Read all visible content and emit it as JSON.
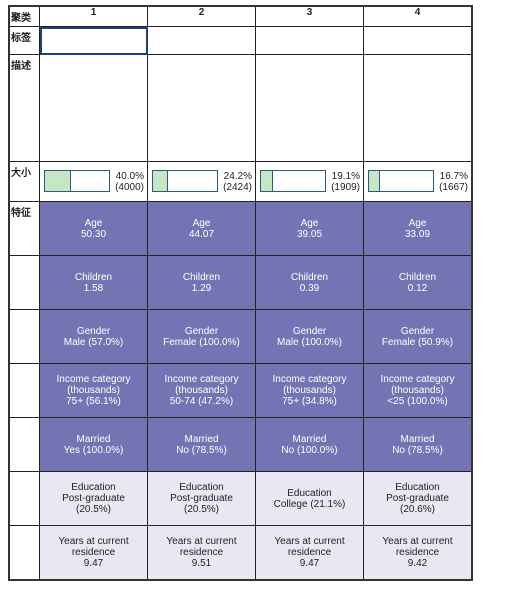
{
  "row_headers": {
    "cluster": "聚类",
    "label": "标签",
    "description": "描述",
    "size": "大小",
    "features": "特征"
  },
  "clusters": [
    {
      "id": "1",
      "size_pct": "40.0%",
      "size_count": "(4000)",
      "fill": 40.0,
      "features": [
        [
          "Age",
          "50.30"
        ],
        [
          "Children",
          "1.58"
        ],
        [
          "Gender",
          "Male (57.0%)"
        ],
        [
          "Income category",
          "(thousands)",
          "75+ (56.1%)"
        ],
        [
          "Married",
          "Yes (100.0%)"
        ],
        [
          "Education",
          "Post-graduate",
          "(20.5%)"
        ],
        [
          "Years at current",
          "residence",
          "9.47"
        ]
      ]
    },
    {
      "id": "2",
      "size_pct": "24.2%",
      "size_count": "(2424)",
      "fill": 24.2,
      "features": [
        [
          "Age",
          "44.07"
        ],
        [
          "Children",
          "1.29"
        ],
        [
          "Gender",
          "Female (100.0%)"
        ],
        [
          "Income category",
          "(thousands)",
          "50-74 (47.2%)"
        ],
        [
          "Married",
          "No (78.5%)"
        ],
        [
          "Education",
          "Post-graduate",
          "(20.5%)"
        ],
        [
          "Years at current",
          "residence",
          "9.51"
        ]
      ]
    },
    {
      "id": "3",
      "size_pct": "19.1%",
      "size_count": "(1909)",
      "fill": 19.1,
      "features": [
        [
          "Age",
          "39.05"
        ],
        [
          "Children",
          "0.39"
        ],
        [
          "Gender",
          "Male (100.0%)"
        ],
        [
          "Income category",
          "(thousands)",
          "75+ (34.8%)"
        ],
        [
          "Married",
          "No (100.0%)"
        ],
        [
          "Education",
          "College (21.1%)"
        ],
        [
          "Years at current",
          "residence",
          "9.47"
        ]
      ]
    },
    {
      "id": "4",
      "size_pct": "16.7%",
      "size_count": "(1667)",
      "fill": 16.7,
      "features": [
        [
          "Age",
          "33.09"
        ],
        [
          "Children",
          "0.12"
        ],
        [
          "Gender",
          "Female (50.9%)"
        ],
        [
          "Income category",
          "(thousands)",
          "<25 (100.0%)"
        ],
        [
          "Married",
          "No (78.5%)"
        ],
        [
          "Education",
          "Post-graduate",
          "(20.6%)"
        ],
        [
          "Years at current",
          "residence",
          "9.42"
        ]
      ]
    }
  ],
  "colors": {
    "important_feature": "#7474b4",
    "less_important_feature": "#e8e8f2",
    "size_fill": "#c6e6c6",
    "selection": "#1f3f7a"
  }
}
